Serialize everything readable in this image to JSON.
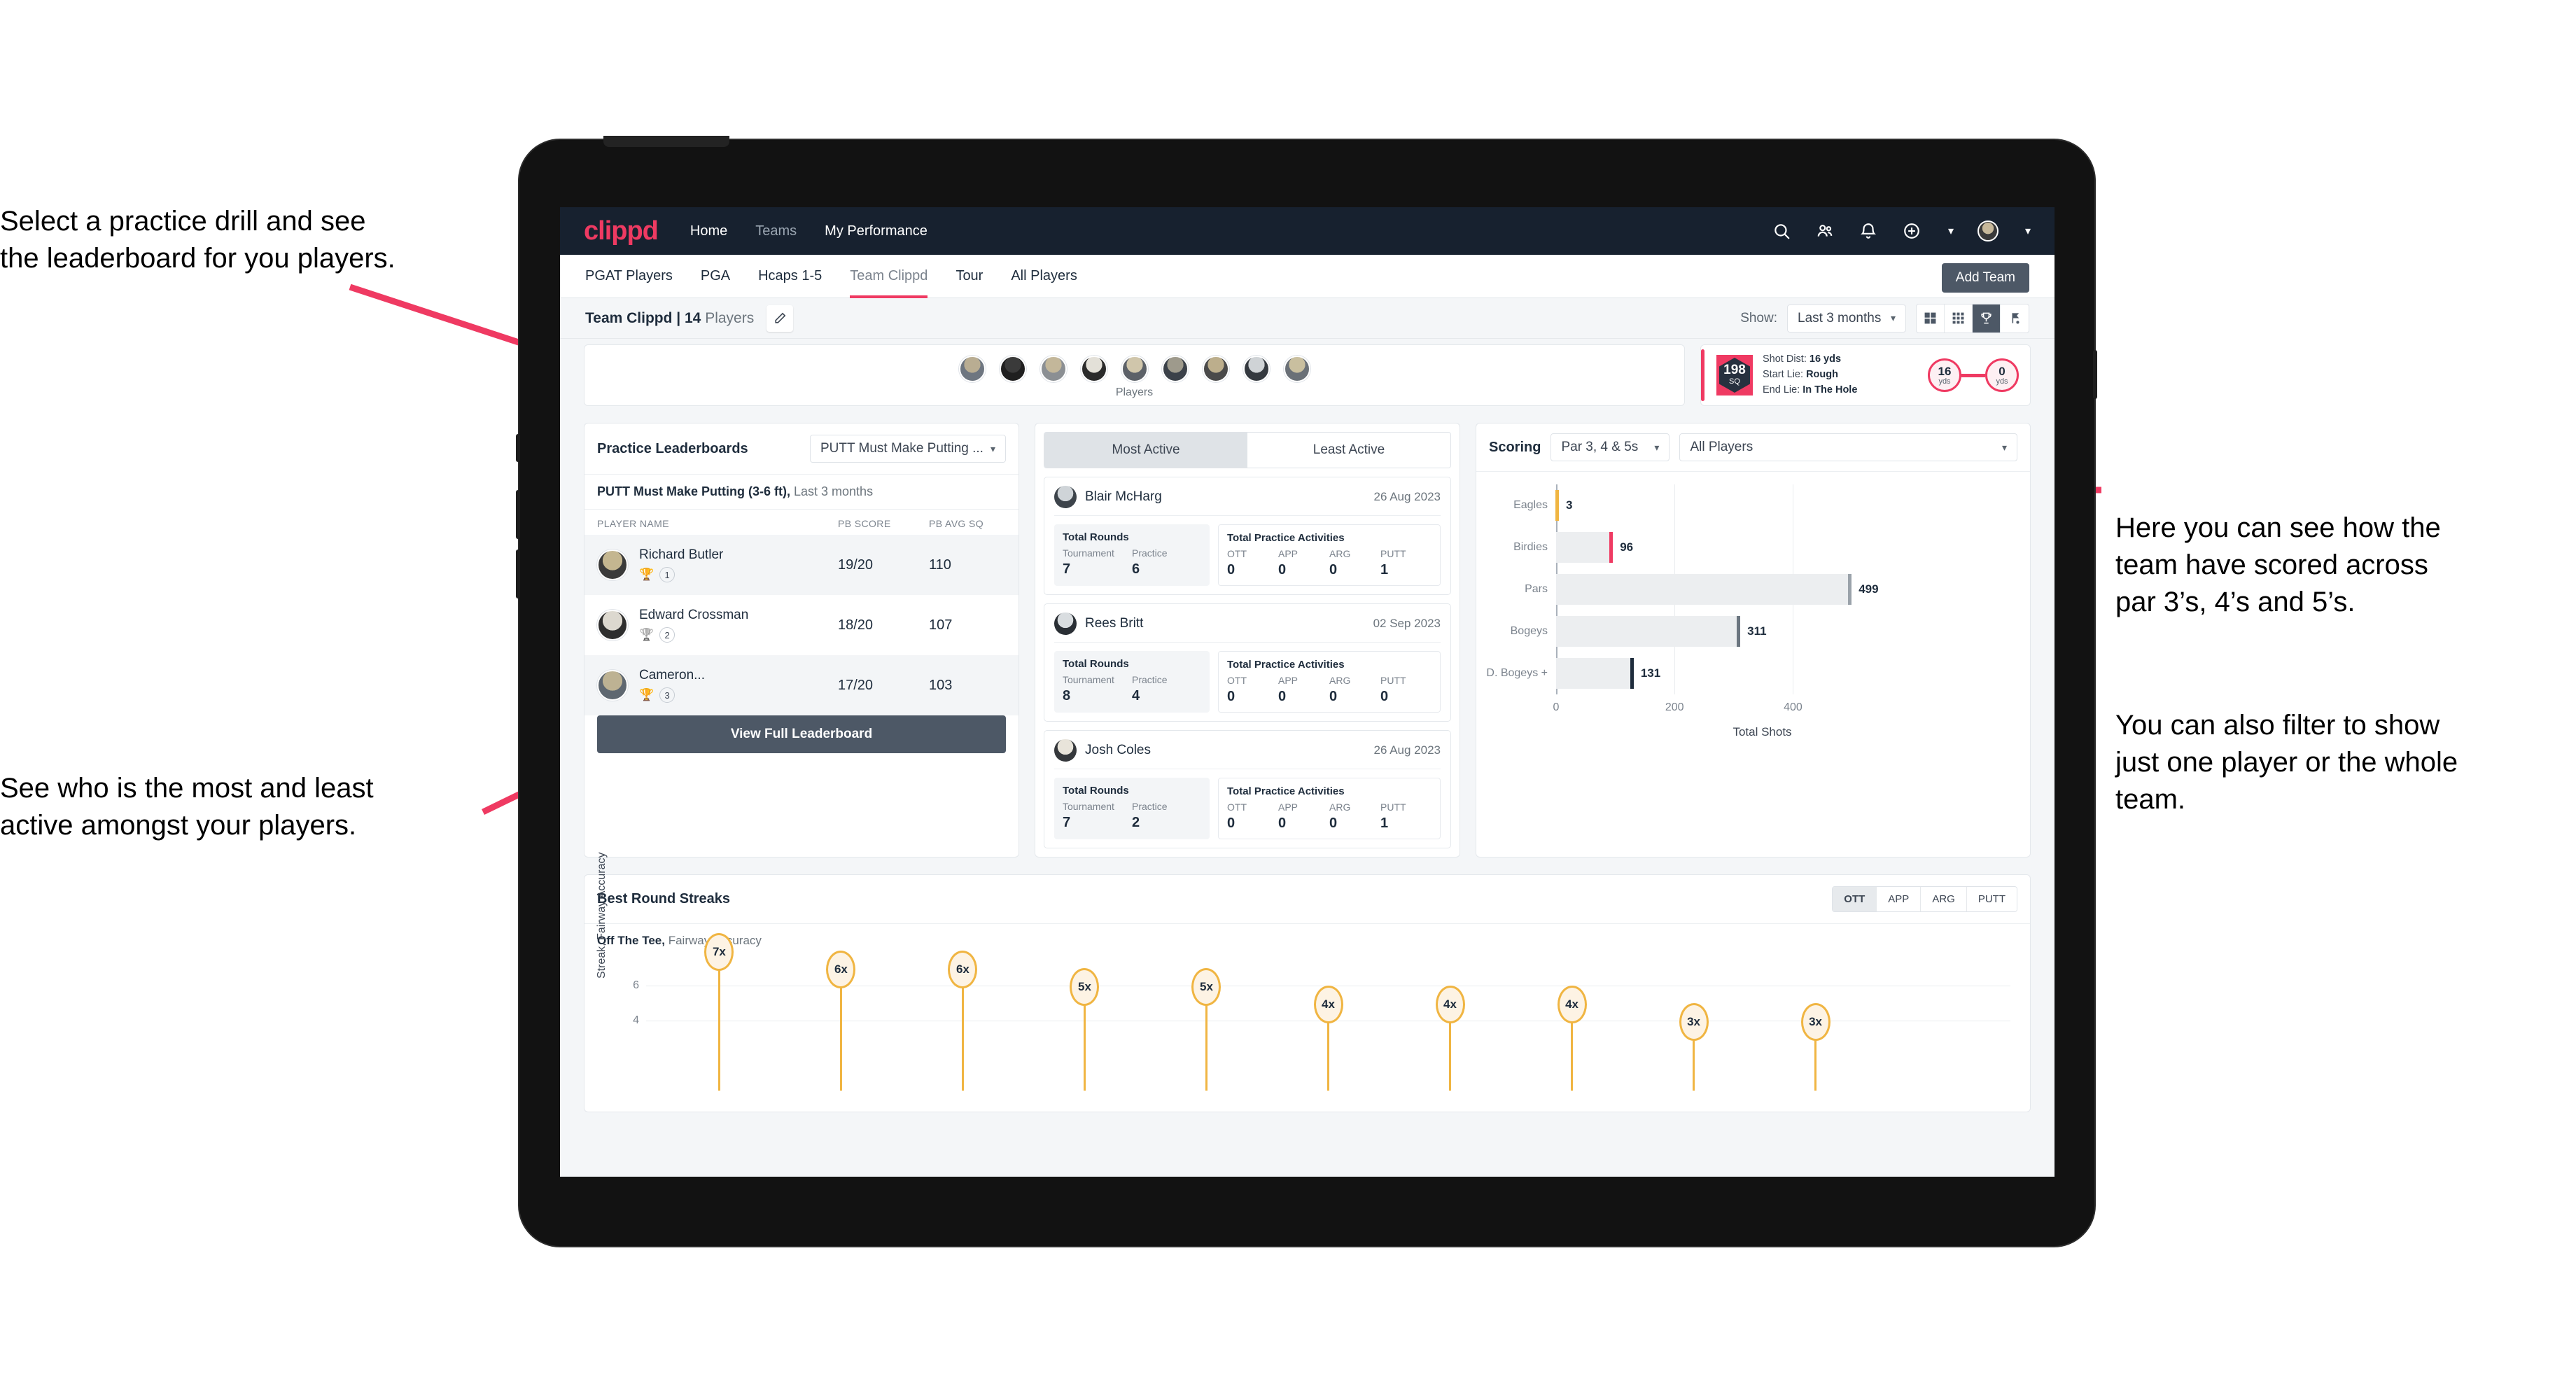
{
  "annotations": {
    "top_left": "Select a practice drill and see\nthe leaderboard for you players.",
    "bottom_left": "See who is the most and least\nactive amongst your players.",
    "right_1": "Here you can see how the\nteam have scored across\npar 3’s, 4’s and 5’s.",
    "right_2": "You can also filter to show\njust one player or the whole\nteam."
  },
  "topnav": {
    "brand": "clippd",
    "links": [
      {
        "label": "Home",
        "active": true
      },
      {
        "label": "Teams",
        "active": false
      },
      {
        "label": "My Performance",
        "active": true
      }
    ],
    "icons": [
      "search-icon",
      "people-icon",
      "bell-icon",
      "plus-circle-icon",
      "avatar"
    ]
  },
  "tabs": [
    {
      "label": "PGAT Players",
      "active": false
    },
    {
      "label": "PGA",
      "active": false
    },
    {
      "label": "Hcaps 1-5",
      "active": false
    },
    {
      "label": "Team Clippd",
      "active": true
    },
    {
      "label": "Tour",
      "active": false
    },
    {
      "label": "All Players",
      "active": false
    }
  ],
  "add_team_button": "Add Team",
  "team_strip": {
    "team_name": "Team Clippd",
    "separator": " | ",
    "player_count": "14",
    "players_word": "Players",
    "edit_icon": "pencil-icon",
    "show_label": "Show:",
    "show_value": "Last 3 months",
    "view_toggles": [
      "grid-large-icon",
      "grid-small-icon",
      "trophy-icon",
      "flag-icon"
    ],
    "active_toggle_index": 2
  },
  "players_row": {
    "caption": "Players",
    "avatar_count": 9
  },
  "shot_card": {
    "badge_value": "198",
    "badge_unit": "SQ",
    "lines": [
      {
        "label": "Shot Dist:",
        "value": "16 yds"
      },
      {
        "label": "Start Lie:",
        "value": "Rough"
      },
      {
        "label": "End Lie:",
        "value": "In The Hole"
      }
    ],
    "start_value": "16",
    "start_unit": "yds",
    "end_value": "0",
    "end_unit": "yds"
  },
  "practice_leaderboard": {
    "title": "Practice Leaderboards",
    "drill_select": "PUTT Must Make Putting ...",
    "subtitle_bold": "PUTT Must Make Putting (3-6 ft),",
    "subtitle_dim": " Last 3 months",
    "columns": [
      "PLAYER NAME",
      "PB SCORE",
      "PB AVG SQ"
    ],
    "rows": [
      {
        "name": "Richard Butler",
        "trophy": "gold",
        "rank": "1",
        "pb_score": "19/20",
        "pb_avg_sq": "110",
        "highlight": true
      },
      {
        "name": "Edward Crossman",
        "trophy": "silver",
        "rank": "2",
        "pb_score": "18/20",
        "pb_avg_sq": "107",
        "highlight": false
      },
      {
        "name": "Cameron...",
        "trophy": "bronze",
        "rank": "3",
        "pb_score": "17/20",
        "pb_avg_sq": "103",
        "highlight": true
      }
    ],
    "view_full_button": "View Full Leaderboard"
  },
  "activity": {
    "tabs": [
      {
        "label": "Most Active",
        "active": true
      },
      {
        "label": "Least Active",
        "active": false
      }
    ],
    "rounds_title": "Total Rounds",
    "rounds_labels": [
      "Tournament",
      "Practice"
    ],
    "practice_title": "Total Practice Activities",
    "practice_labels": [
      "OTT",
      "APP",
      "ARG",
      "PUTT"
    ],
    "cards": [
      {
        "name": "Blair McHarg",
        "date": "26 Aug 2023",
        "rounds": [
          "7",
          "6"
        ],
        "practice": [
          "0",
          "0",
          "0",
          "1"
        ]
      },
      {
        "name": "Rees Britt",
        "date": "02 Sep 2023",
        "rounds": [
          "8",
          "4"
        ],
        "practice": [
          "0",
          "0",
          "0",
          "0"
        ]
      },
      {
        "name": "Josh Coles",
        "date": "26 Aug 2023",
        "rounds": [
          "7",
          "2"
        ],
        "practice": [
          "0",
          "0",
          "0",
          "1"
        ]
      }
    ]
  },
  "scoring": {
    "title": "Scoring",
    "par_select": "Par 3, 4 & 5s",
    "player_select": "All Players"
  },
  "streaks": {
    "title": "Best Round Streaks",
    "toggles": [
      {
        "label": "OTT",
        "active": true
      },
      {
        "label": "APP",
        "active": false
      },
      {
        "label": "ARG",
        "active": false
      },
      {
        "label": "PUTT",
        "active": false
      }
    ],
    "subtitle_bold": "Off The Tee,",
    "subtitle_dim": " Fairway Accuracy"
  },
  "chart_data": [
    {
      "type": "bar",
      "orientation": "horizontal",
      "title": "Scoring",
      "categories": [
        "Eagles",
        "Birdies",
        "Pars",
        "Bogeys",
        "D. Bogeys +"
      ],
      "values": [
        3,
        96,
        499,
        311,
        131
      ],
      "cap_colors": [
        "#f0b542",
        "#ef3a62",
        "#9aa2aa",
        "#6b7680",
        "#1e2c3c"
      ],
      "xlabel": "Total Shots",
      "ylabel": "",
      "xticks": [
        0,
        200,
        400
      ],
      "xlim": [
        0,
        520
      ],
      "grid": true,
      "legend": false
    },
    {
      "type": "scatter",
      "subtype": "lollipop",
      "title": "Best Round Streaks",
      "ylabel": "Streak, Fairway Accuracy",
      "xlabel": "",
      "ylim": [
        0,
        8
      ],
      "yticks": [
        4,
        6
      ],
      "values": [
        7,
        6,
        6,
        5,
        5,
        4,
        4,
        4,
        3,
        3
      ],
      "labels": [
        "7x",
        "6x",
        "6x",
        "5x",
        "5x",
        "4x",
        "4x",
        "4x",
        "3x",
        "3x"
      ],
      "grid": true,
      "legend": false,
      "marker_color": "#f0b542"
    }
  ]
}
